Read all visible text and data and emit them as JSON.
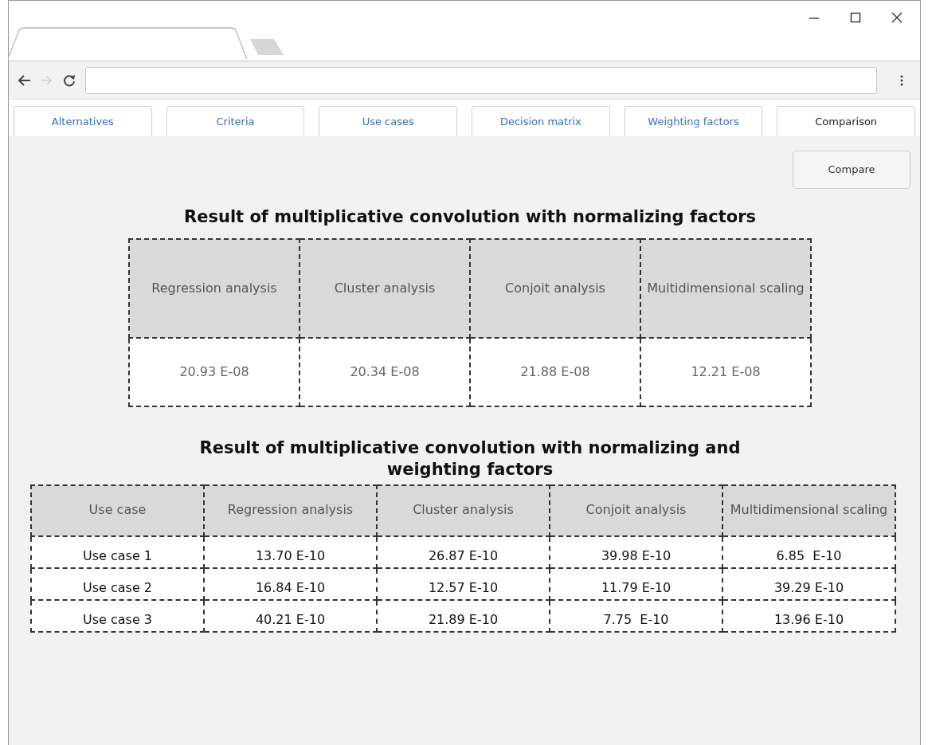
{
  "tabs": [
    {
      "label": "Alternatives",
      "selected": false
    },
    {
      "label": "Criteria",
      "selected": false
    },
    {
      "label": "Use cases",
      "selected": false
    },
    {
      "label": "Decision matrix",
      "selected": false
    },
    {
      "label": "Weighting factors",
      "selected": false
    },
    {
      "label": "Comparison",
      "selected": true
    }
  ],
  "compare_button": "Compare",
  "tables": [
    {
      "title": "Result of multiplicative convolution with normalizing factors",
      "columns": [
        "Regression analysis",
        "Cluster analysis",
        "Conjoit analysis",
        "Multidimensional scaling"
      ],
      "rows": [
        [
          "20.93 E-08",
          "20.34 E-08",
          "21.88 E-08",
          "12.21 E-08"
        ]
      ]
    },
    {
      "title": "Result of multiplicative convolution with normalizing and weighting factors",
      "columns": [
        "Use case",
        "Regression analysis",
        "Cluster analysis",
        "Conjoit analysis",
        "Multidimensional scaling"
      ],
      "rows": [
        [
          "Use case 1",
          "13.70 E-10",
          "26.87 E-10",
          "39.98 E-10",
          "6.85  E-10"
        ],
        [
          "Use case 2",
          "16.84 E-10",
          "12.57 E-10",
          "11.79 E-10",
          "39.29 E-10"
        ],
        [
          "Use case 3",
          "40.21 E-10",
          "21.89 E-10",
          "7.75  E-10",
          "13.96 E-10"
        ]
      ]
    }
  ]
}
